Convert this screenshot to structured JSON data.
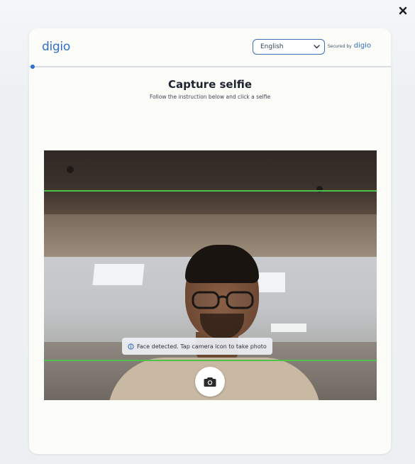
{
  "window": {
    "close_glyph": "×"
  },
  "header": {
    "logo_text": "digio",
    "language_select": {
      "value": "English"
    },
    "secured_label": "Secured by",
    "secured_brand": "digio"
  },
  "progress": {
    "value": 0.01
  },
  "main": {
    "title": "Capture selfie",
    "subtitle": "Follow the instruction below and click a selfie"
  },
  "camera": {
    "status_message": "Face detected. Tap camera icon to take photo",
    "status_icon": "info-icon",
    "shutter_icon": "camera-icon",
    "guide_color": "#4fc24c"
  },
  "colors": {
    "brand": "#2f6fcb",
    "card_background": "#fcfcf9",
    "page_background": "#eef1f4"
  }
}
